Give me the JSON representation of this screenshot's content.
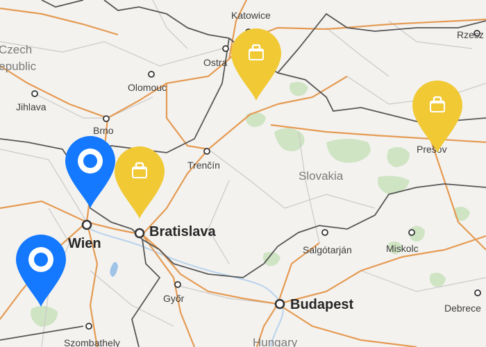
{
  "map": {
    "colors": {
      "land": "#f3f2ef",
      "major_road": "#e59a52",
      "minor_road": "#c9c9c9",
      "border": "#555555",
      "forest": "#cfe4c3",
      "water": "#9ec3e6",
      "pin_blue": "#1479ff",
      "pin_yellow": "#f0c935"
    },
    "country_labels": {
      "czech_line1": "Czech",
      "czech_line2": "Republic",
      "slovakia": "Slovakia",
      "hungary": "Hungary"
    },
    "cities": {
      "katowice": "Katowice",
      "rzeszow": "Rzesz",
      "ostrava": "Ostra",
      "olomouc": "Olomouc",
      "jihlava": "Jihlava",
      "brno": "Brno",
      "trencin": "Trenčín",
      "presov": "Prešov",
      "bratislava": "Bratislava",
      "wien": "Wien",
      "salgotarjan": "Salgótarján",
      "miskolc": "Miskolc",
      "gyor": "Győr",
      "budapest": "Budapest",
      "debrecen": "Debrece",
      "szombathely": "Szombathely"
    },
    "pins": {
      "blue": "location-pin",
      "yellow": "briefcase-pin"
    }
  }
}
